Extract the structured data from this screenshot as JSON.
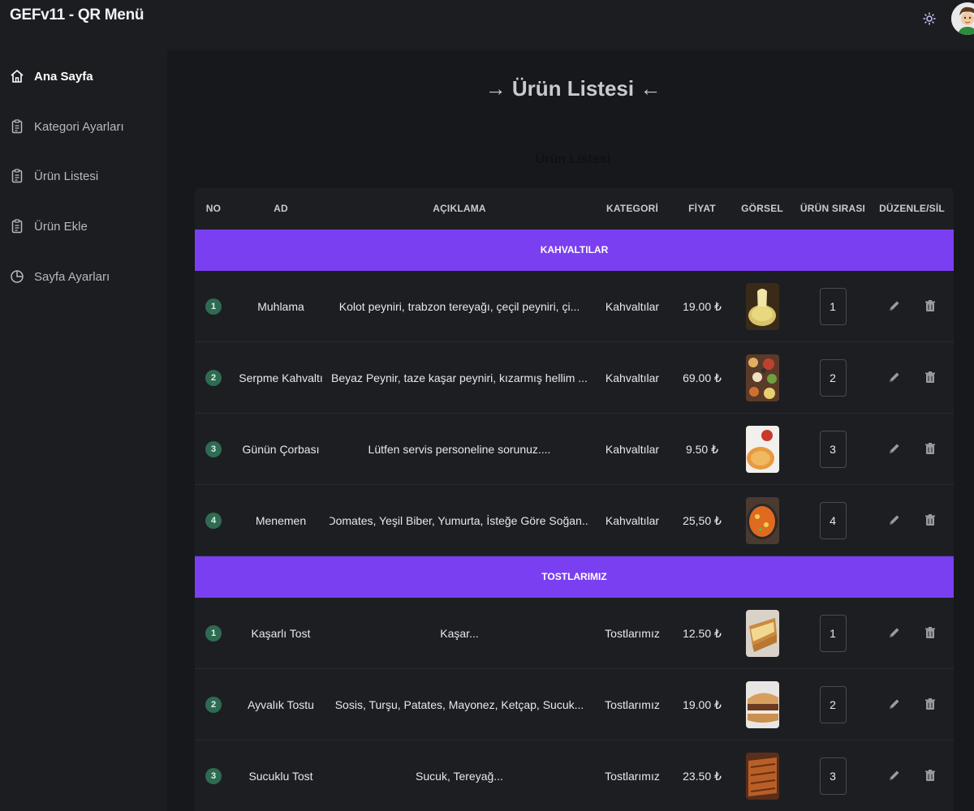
{
  "app": {
    "title": "GEFv11 - QR Menü"
  },
  "sidebar": {
    "items": [
      {
        "label": "Ana Sayfa",
        "icon": "home-icon",
        "active": true
      },
      {
        "label": "Kategori Ayarları",
        "icon": "clipboard-icon"
      },
      {
        "label": "Ürün Listesi",
        "icon": "clipboard-icon"
      },
      {
        "label": "Ürün Ekle",
        "icon": "clipboard-icon"
      },
      {
        "label": "Sayfa Ayarları",
        "icon": "pie-chart-icon"
      }
    ]
  },
  "main": {
    "page_title": "→ Ürün Listesi ←",
    "section_title": "Ürün Listesi"
  },
  "table": {
    "headers": [
      "NO",
      "AD",
      "AÇIKLAMA",
      "KATEGORİ",
      "FİYAT",
      "GÖRSEL",
      "ÜRÜN SIRASI",
      "DÜZENLE/SİL"
    ],
    "groups": [
      {
        "name": "KAHVALTILAR",
        "rows": [
          {
            "no": "1",
            "name": "Muhlama",
            "description": "Kolot peyniri, trabzon tereyağı, çeçil peyniri, çi...",
            "category": "Kahvaltılar",
            "price": "19.00 ₺",
            "order": "1",
            "image": "cheese-dip"
          },
          {
            "no": "2",
            "name": "Serpme Kahvaltı",
            "description": "Beyaz Peynir, taze kaşar peyniri, kızarmış hellim ...",
            "category": "Kahvaltılar",
            "price": "69.00 ₺",
            "order": "2",
            "image": "breakfast-spread"
          },
          {
            "no": "3",
            "name": "Günün Çorbası",
            "description": "Lütfen servis personeline sorunuz....",
            "category": "Kahvaltılar",
            "price": "9.50 ₺",
            "order": "3",
            "image": "soup"
          },
          {
            "no": "4",
            "name": "Menemen",
            "description": "Domates, Yeşil Biber, Yumurta, İsteğe Göre Soğan...",
            "category": "Kahvaltılar",
            "price": "25,50 ₺",
            "order": "4",
            "image": "menemen"
          }
        ]
      },
      {
        "name": "TOSTLARIMIZ",
        "rows": [
          {
            "no": "1",
            "name": "Kaşarlı Tost",
            "description": "Kaşar...",
            "category": "Tostlarımız",
            "price": "12.50 ₺",
            "order": "1",
            "image": "toast"
          },
          {
            "no": "2",
            "name": "Ayvalık Tostu",
            "description": "Sosis, Turşu, Patates, Mayonez, Ketçap, Sucuk...",
            "category": "Tostlarımız",
            "price": "19.00 ₺",
            "order": "2",
            "image": "sandwich"
          },
          {
            "no": "3",
            "name": "Sucuklu Tost",
            "description": "Sucuk, Tereyağ...",
            "category": "Tostlarımız",
            "price": "23.50 ₺",
            "order": "3",
            "image": "grilled-toast"
          }
        ]
      }
    ]
  },
  "colors": {
    "accent": "#7a3ff0",
    "badge": "#2f6b52",
    "background": "#17181b",
    "sidebar": "#1c1d21"
  }
}
